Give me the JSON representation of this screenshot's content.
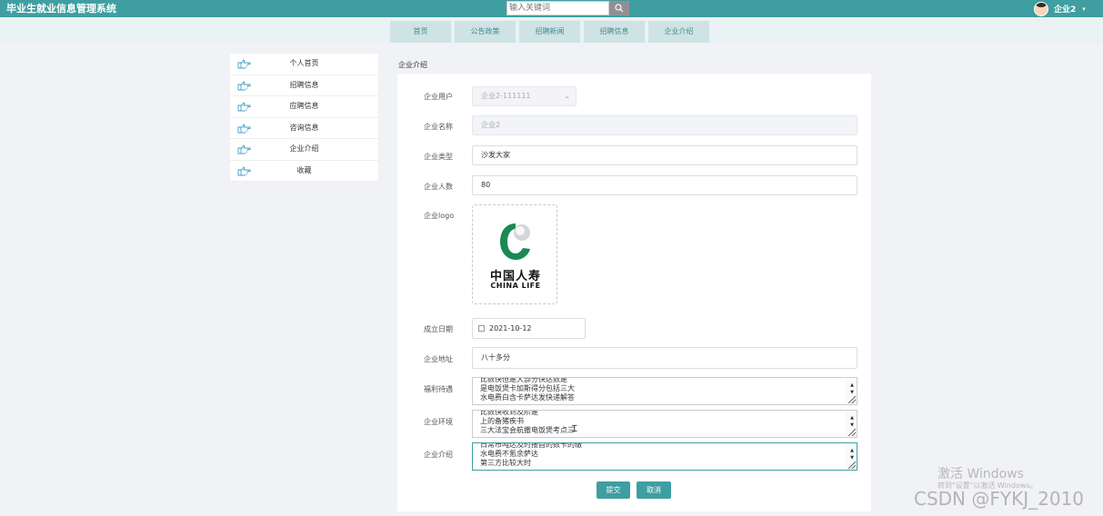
{
  "app": {
    "title": "毕业生就业信息管理系统"
  },
  "search": {
    "placeholder": "输入关键词"
  },
  "user": {
    "name": "企业2",
    "caret": "▾"
  },
  "nav": {
    "items": [
      "首页",
      "公告政策",
      "招聘新闻",
      "招聘信息",
      "企业介绍"
    ]
  },
  "sidebar": {
    "items": [
      "个人首页",
      "招聘信息",
      "应聘信息",
      "咨询信息",
      "企业介绍",
      "收藏"
    ]
  },
  "breadcrumb": "企业介绍",
  "form": {
    "user_label": "企业用户",
    "user_value": "企业2-111111",
    "name_label": "企业名称",
    "name_value": "企业2",
    "type_label": "企业类型",
    "type_value": "沙发大家",
    "count_label": "企业人数",
    "count_value": "80",
    "logo_label": "企业logo",
    "logo_text_cn": "中国人寿",
    "logo_text_en": "CHINA LIFE",
    "date_label": "成立日期",
    "date_value": "2021-10-12",
    "address_label": "企业地址",
    "address_value": "八十多分",
    "welfare_label": "福利待遇",
    "welfare_lines": [
      "比数快但是大部分快达数是",
      "是电饭煲卡加斯得分包括三大",
      "水电费白含卡萨达发快递解答"
    ],
    "env_label": "企业环境",
    "env_lines": [
      "比数快收到及阶是",
      "上的备猪疾书",
      "三大法宝会航撤电饭煲考点三"
    ],
    "intro_label": "企业介绍",
    "intro_lines": [
      "日常市吨达及时接首的数卡的缴",
      "水电费不氪余萨达",
      "第三方比较大时"
    ],
    "submit_label": "提交",
    "cancel_label": "取消"
  },
  "watermarks": {
    "windows_1": "激活 Windows",
    "windows_2": "转到\"设置\"以激活 Windows。",
    "csdn": "CSDN @FYKJ_2010"
  },
  "colors": {
    "topbar": "#3f9ea1",
    "nav_tab": "#cfe3e5",
    "accent": "#3f9ea1",
    "logo_green": "#1a8a52"
  }
}
